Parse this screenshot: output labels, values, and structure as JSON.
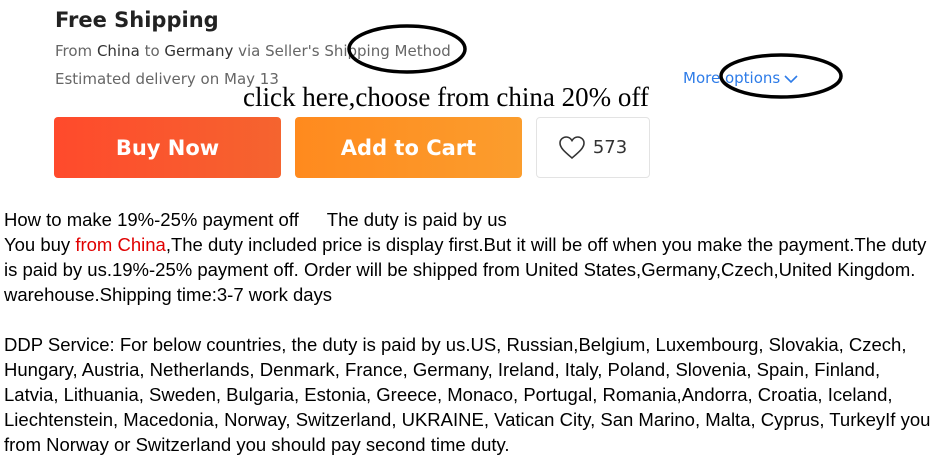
{
  "shipping": {
    "title": "Free Shipping",
    "route_from_prefix": "From ",
    "route_origin": "China",
    "route_mid": " to ",
    "route_destination": "Germany",
    "route_suffix": " via Seller's Shipping Method",
    "delivery": "Estimated delivery on May 13",
    "more_options_label": "More options"
  },
  "promo_text": "click here,choose from china 20% off",
  "actions": {
    "buy_now_label": "Buy Now",
    "add_to_cart_label": "Add to Cart",
    "wishlist_count": "573"
  },
  "description": {
    "heading_left": "How to make 19%-25% payment off",
    "heading_right": "The duty is paid by us",
    "para1_prefix": "You buy ",
    "para1_highlight": "from China",
    "para1_rest": ",The duty included price is display first.But it will be off when you make the payment.The duty is paid by us.19%-25% payment off. Order will be shipped from United States,Germany,Czech,United Kingdom. warehouse.Shipping time:3-7 work days",
    "para2": "DDP Service: For below countries, the duty is paid by us.US, Russian,Belgium, Luxembourg, Slovakia, Czech, Hungary, Austria, Netherlands, Denmark, France, Germany, Ireland, Italy, Poland, Slovenia, Spain, Finland, Latvia, Lithuania, Sweden, Bulgaria, Estonia, Greece, Monaco, Portugal, Romania,Andorra, Croatia, Iceland, Liechtenstein, Macedonia, Norway, Switzerland, UKRAINE, Vatican City, San Marino, Malta, Cyprus, TurkeyIf you from Norway or Switzerland you should pay second time duty."
  },
  "colors": {
    "buy_now": "#ff4a2c",
    "add_to_cart": "#ff8a1e",
    "link": "#2e7ce8",
    "highlight_red": "#e00000"
  },
  "icons": {
    "wishlist": "heart-icon",
    "more_options": "chevron-down-icon"
  }
}
